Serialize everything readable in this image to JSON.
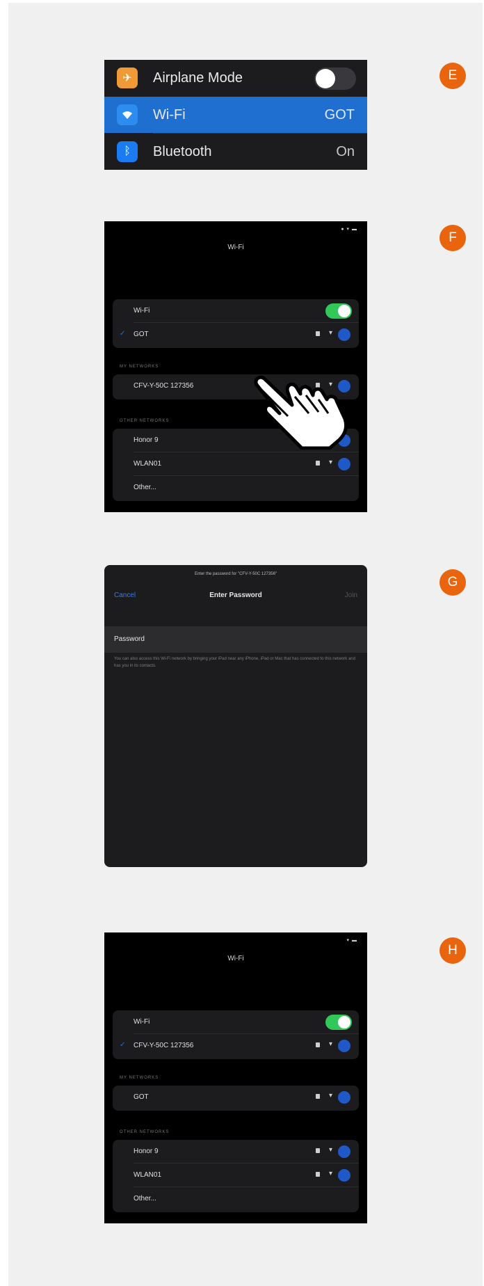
{
  "badges": {
    "e": "E",
    "f": "F",
    "g": "G",
    "h": "H"
  },
  "colors": {
    "badge": "#e8650d",
    "wifi_row_active": "#1f6fd1",
    "toggle_on": "#32c759",
    "link_blue": "#2f7bf5"
  },
  "panel_e": {
    "rows": [
      {
        "label": "Airplane Mode",
        "icon": "airplane-icon",
        "value": ""
      },
      {
        "label": "Wi-Fi",
        "icon": "wifi-icon",
        "value": "GOT"
      },
      {
        "label": "Bluetooth",
        "icon": "bluetooth-icon",
        "value": "On"
      }
    ]
  },
  "panel_f": {
    "status": "●  ▾  ▬",
    "title": "Wi-Fi",
    "wifi_label": "Wi-Fi",
    "connected": "GOT",
    "my_networks_header": "MY NETWORKS",
    "my_networks": [
      "CFV-Y-50C 127356"
    ],
    "other_header": "OTHER NETWORKS",
    "other_networks": [
      "Honor 9",
      "WLAN01"
    ],
    "other_label": "Other..."
  },
  "panel_g": {
    "prompt": "Enter the password for \"CFV-Y-50C 127356\"",
    "cancel": "Cancel",
    "title": "Enter Password",
    "join": "Join",
    "password_label": "Password",
    "note": "You can also access this Wi-Fi network by bringing your iPad near any iPhone, iPad or Mac that has connected to this network and has you in its contacts."
  },
  "panel_h": {
    "status": "▾  ▬",
    "title": "Wi-Fi",
    "wifi_label": "Wi-Fi",
    "connected": "CFV-Y-50C 127356",
    "my_networks_header": "MY NETWORKS",
    "my_networks": [
      "GOT"
    ],
    "other_header": "OTHER NETWORKS",
    "other_networks": [
      "Honor 9",
      "WLAN01"
    ],
    "other_label": "Other..."
  }
}
